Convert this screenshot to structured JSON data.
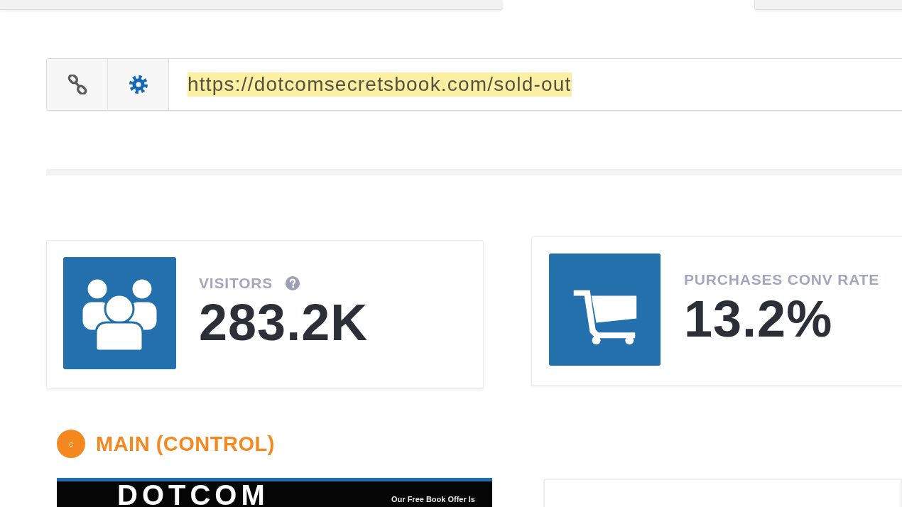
{
  "url_bar": {
    "buttons": [
      {
        "kind": "link"
      },
      {
        "kind": "settings"
      }
    ],
    "url": {
      "value": "https://dotcomsecretsbook.com/sold-out",
      "highlighted": true
    }
  },
  "stats": [
    {
      "kind": "visitors",
      "label": "VISITORS",
      "help": true,
      "value": "283.2K"
    },
    {
      "kind": "cart",
      "label": "PURCHASES CONV RATE",
      "help": false,
      "value": "13.2%"
    }
  ],
  "variant": {
    "badge": "c",
    "title": "MAIN (CONTROL)",
    "preview": {
      "headline": "DOTCOM",
      "tagline": "Our Free Book Offer Is"
    }
  }
}
